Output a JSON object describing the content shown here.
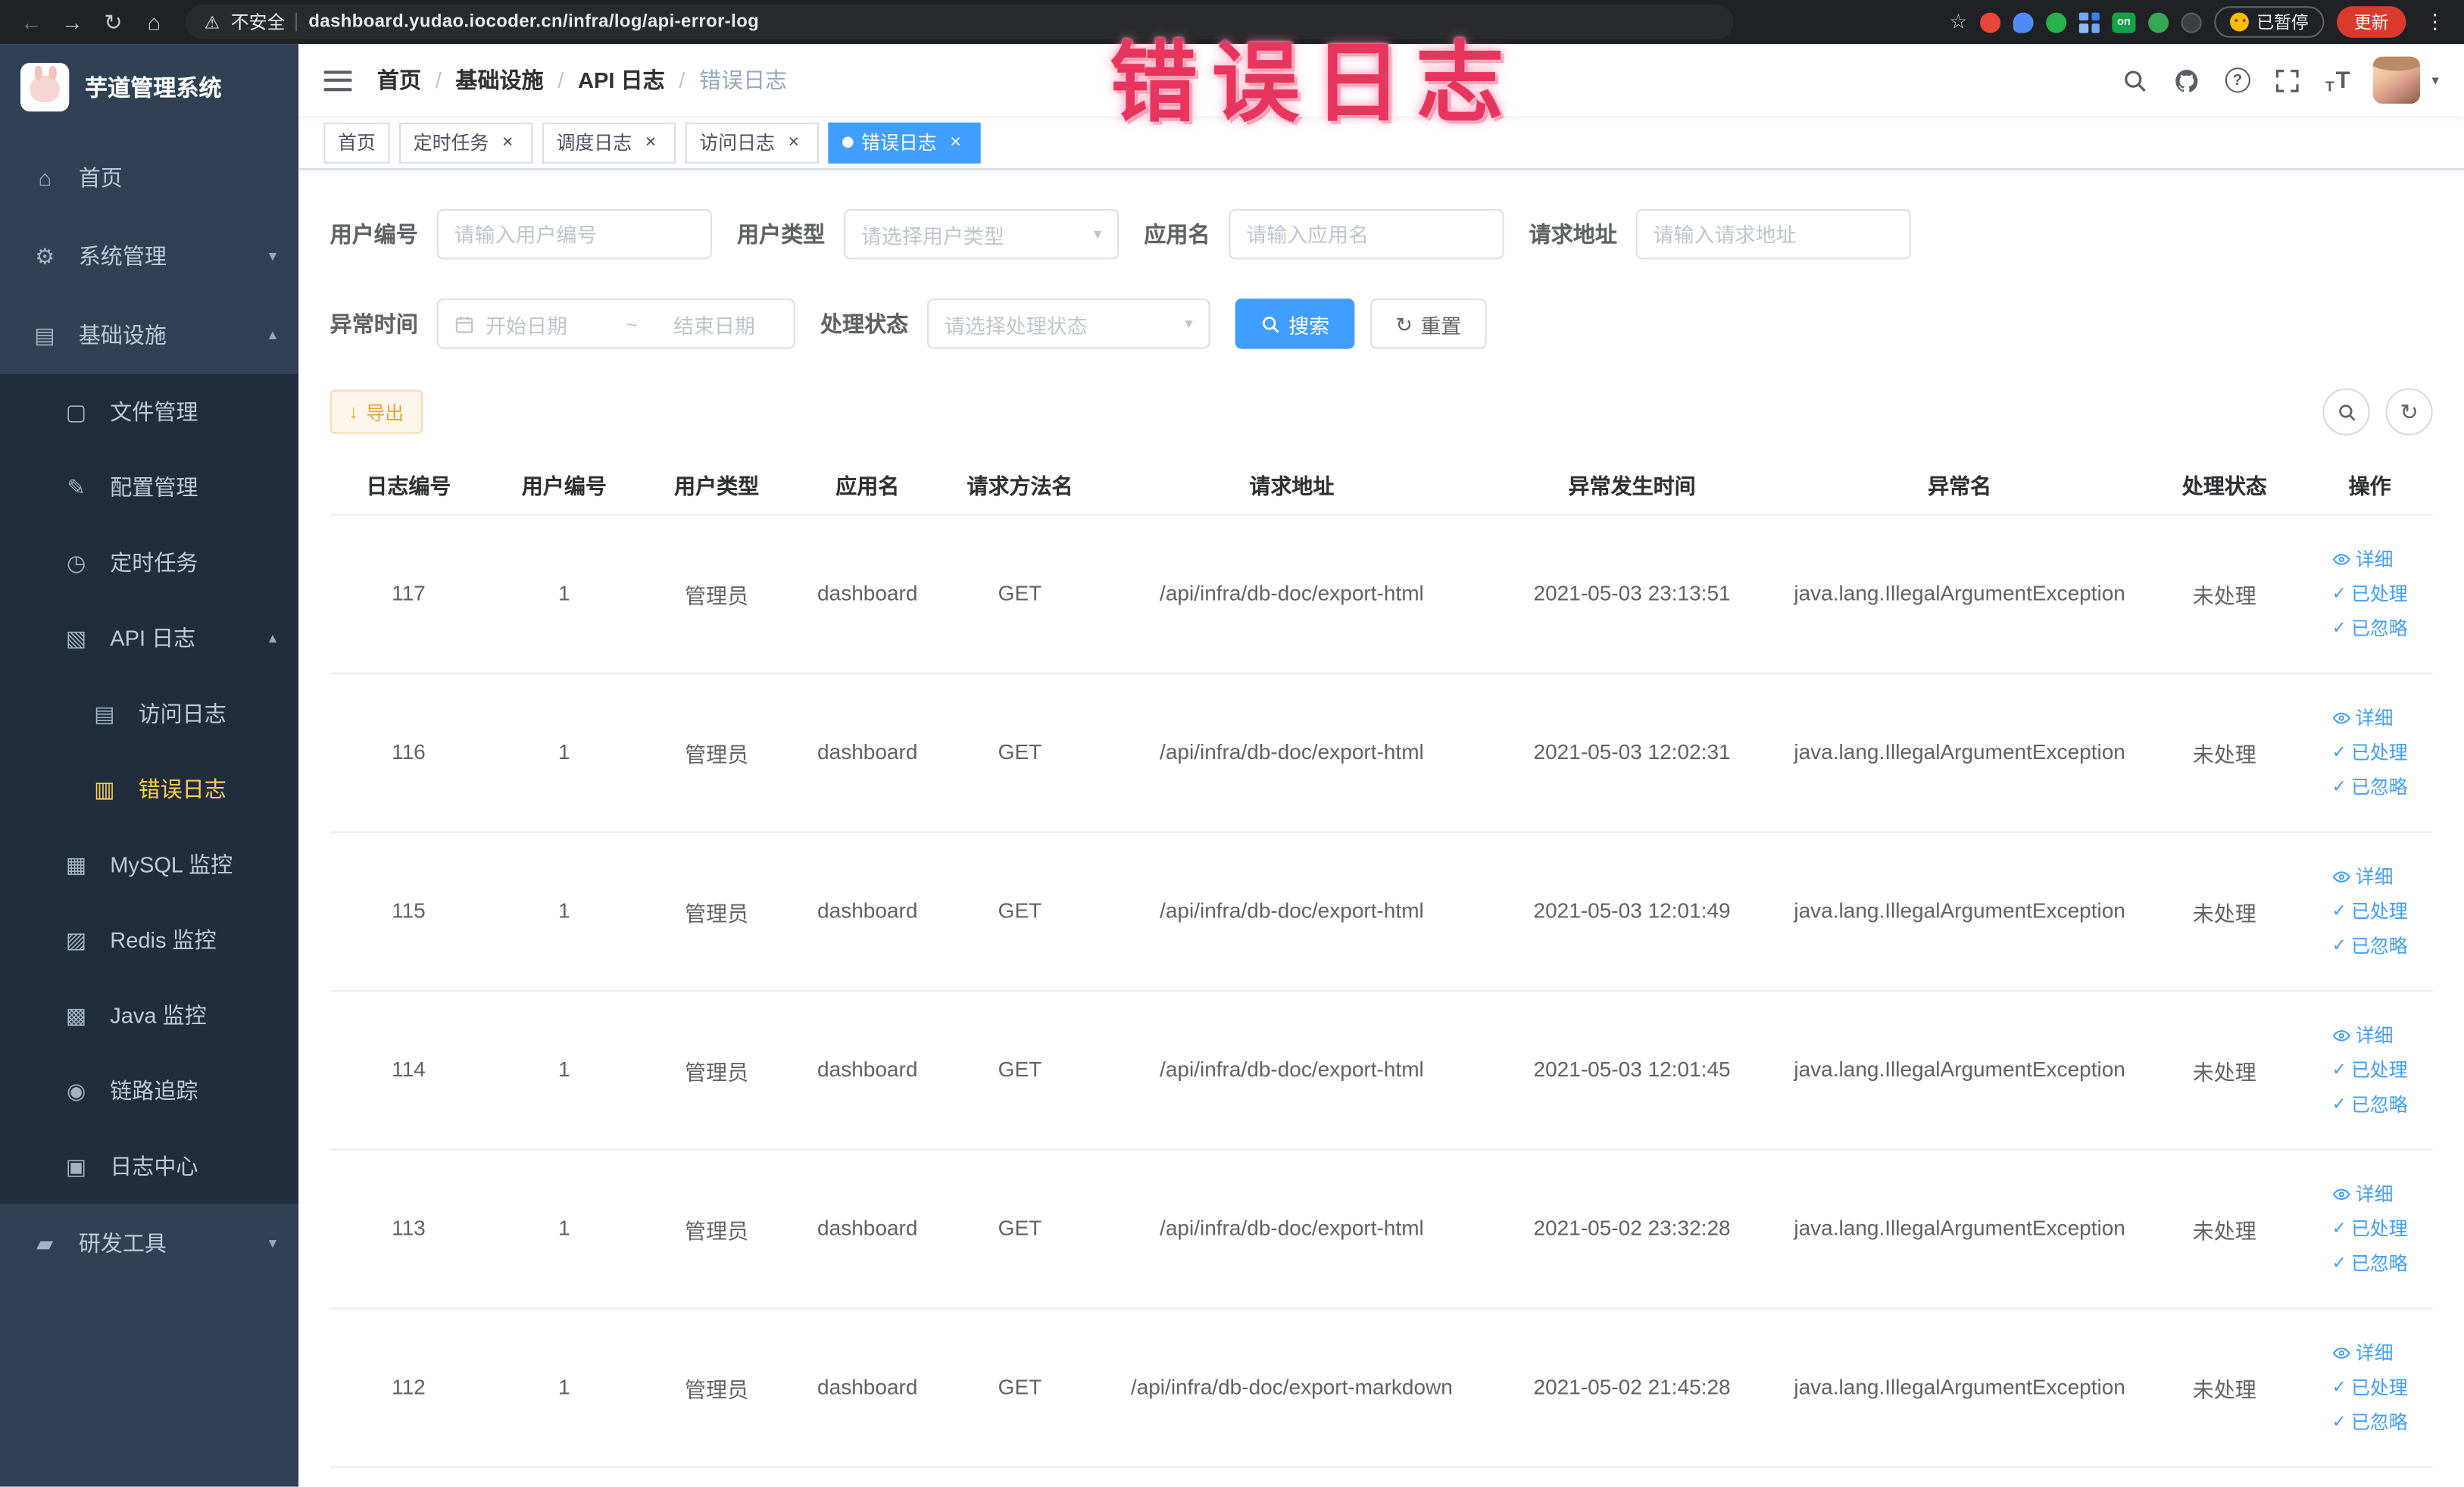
{
  "browser": {
    "security_label": "不安全",
    "url": "dashboard.yudao.iocoder.cn/infra/log/api-error-log",
    "extension_on_badge": "on",
    "paused_label": "已暂停",
    "update_label": "更新"
  },
  "watermark": "错误日志",
  "icons": {
    "back": "←",
    "forward": "→",
    "reload": "↻",
    "home": "⌂",
    "warning": "⚠",
    "star": "☆",
    "kebab": "⋮",
    "caret_down": "▾",
    "chevron_down": "▾",
    "chevron_up": "▴",
    "close": "×",
    "download": "↓",
    "refresh": "↻",
    "question": "?",
    "check": "✓",
    "menu_home": "⌂",
    "menu_system": "⚙",
    "menu_infra": "▤",
    "menu_file": "▢",
    "menu_config": "✎",
    "menu_job": "◷",
    "menu_api_log": "▧",
    "menu_access_log": "▤",
    "menu_error_log": "▥",
    "menu_mysql": "▦",
    "menu_redis": "▨",
    "menu_java": "▩",
    "menu_trace": "◉",
    "menu_log_center": "▣",
    "menu_devtools": "▰",
    "font_size_small": "T",
    "font_size_big": "T"
  },
  "sidebar": {
    "logo_title": "芋道管理系统",
    "items": [
      {
        "label": "首页"
      },
      {
        "label": "系统管理"
      },
      {
        "label": "基础设施"
      },
      {
        "label": "文件管理"
      },
      {
        "label": "配置管理"
      },
      {
        "label": "定时任务"
      },
      {
        "label": "API 日志"
      },
      {
        "label": "访问日志"
      },
      {
        "label": "错误日志"
      },
      {
        "label": "MySQL 监控"
      },
      {
        "label": "Redis 监控"
      },
      {
        "label": "Java 监控"
      },
      {
        "label": "链路追踪"
      },
      {
        "label": "日志中心"
      },
      {
        "label": "研发工具"
      }
    ]
  },
  "breadcrumb": [
    "首页",
    "基础设施",
    "API 日志",
    "错误日志"
  ],
  "tags": [
    {
      "label": "首页"
    },
    {
      "label": "定时任务"
    },
    {
      "label": "调度日志"
    },
    {
      "label": "访问日志"
    },
    {
      "label": "错误日志"
    }
  ],
  "filters": {
    "user_id": {
      "label": "用户编号",
      "placeholder": "请输入用户编号"
    },
    "user_type": {
      "label": "用户类型",
      "placeholder": "请选择用户类型"
    },
    "app_name": {
      "label": "应用名",
      "placeholder": "请输入应用名"
    },
    "request_url": {
      "label": "请求地址",
      "placeholder": "请输入请求地址"
    },
    "exception_time": {
      "label": "异常时间",
      "start_placeholder": "开始日期",
      "separator": "~",
      "end_placeholder": "结束日期"
    },
    "process_status": {
      "label": "处理状态",
      "placeholder": "请选择处理状态"
    },
    "search_label": "搜索",
    "reset_label": "重置"
  },
  "toolbar": {
    "export_label": "导出"
  },
  "table": {
    "columns": [
      "日志编号",
      "用户编号",
      "用户类型",
      "应用名",
      "请求方法名",
      "请求地址",
      "异常发生时间",
      "异常名",
      "处理状态",
      "操作"
    ],
    "actions": {
      "detail": "详细",
      "processed": "已处理",
      "ignored": "已忽略"
    },
    "rows": [
      {
        "log_id": "117",
        "user_id": "1",
        "user_type": "管理员",
        "app_name": "dashboard",
        "method": "GET",
        "url": "/api/infra/db-doc/export-html",
        "time": "2021-05-03 23:13:51",
        "exception": "java.lang.IllegalArgumentException",
        "status": "未处理"
      },
      {
        "log_id": "116",
        "user_id": "1",
        "user_type": "管理员",
        "app_name": "dashboard",
        "method": "GET",
        "url": "/api/infra/db-doc/export-html",
        "time": "2021-05-03 12:02:31",
        "exception": "java.lang.IllegalArgumentException",
        "status": "未处理"
      },
      {
        "log_id": "115",
        "user_id": "1",
        "user_type": "管理员",
        "app_name": "dashboard",
        "method": "GET",
        "url": "/api/infra/db-doc/export-html",
        "time": "2021-05-03 12:01:49",
        "exception": "java.lang.IllegalArgumentException",
        "status": "未处理"
      },
      {
        "log_id": "114",
        "user_id": "1",
        "user_type": "管理员",
        "app_name": "dashboard",
        "method": "GET",
        "url": "/api/infra/db-doc/export-html",
        "time": "2021-05-03 12:01:45",
        "exception": "java.lang.IllegalArgumentException",
        "status": "未处理"
      },
      {
        "log_id": "113",
        "user_id": "1",
        "user_type": "管理员",
        "app_name": "dashboard",
        "method": "GET",
        "url": "/api/infra/db-doc/export-html",
        "time": "2021-05-02 23:32:28",
        "exception": "java.lang.IllegalArgumentException",
        "status": "未处理"
      },
      {
        "log_id": "112",
        "user_id": "1",
        "user_type": "管理员",
        "app_name": "dashboard",
        "method": "GET",
        "url": "/api/infra/db-doc/export-markdown",
        "time": "2021-05-02 21:45:28",
        "exception": "java.lang.IllegalArgumentException",
        "status": "未处理"
      }
    ]
  },
  "colors": {
    "primary": "#409eff",
    "warning": "#e6a23c",
    "sidebar_bg": "#304156",
    "sidebar_sub_bg": "#1f2d3d",
    "sidebar_active": "#ffd04b",
    "tag_active_bg": "#409eff"
  }
}
